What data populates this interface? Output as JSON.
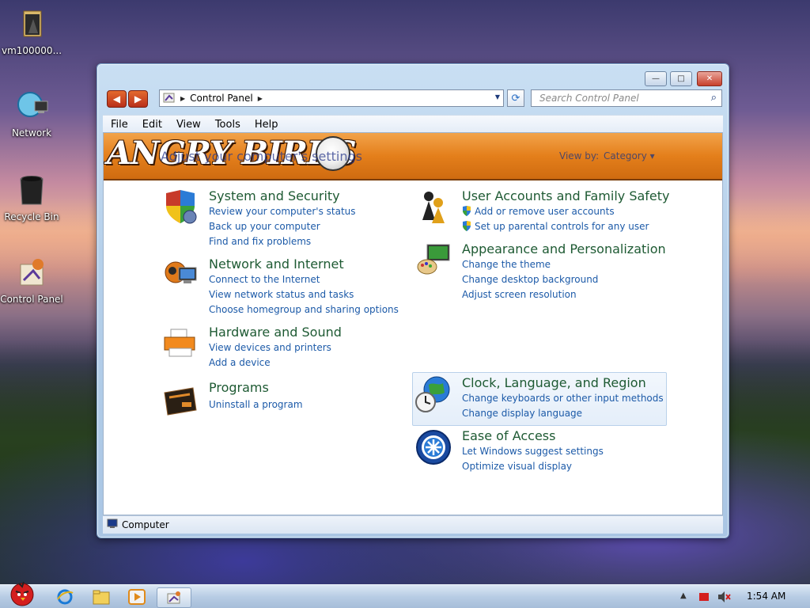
{
  "desktop": {
    "icons": [
      {
        "label": "vm100000..."
      },
      {
        "label": "Network"
      },
      {
        "label": "Recycle Bin"
      },
      {
        "label": "Control Panel"
      }
    ]
  },
  "window": {
    "controls": {
      "minimize": "—",
      "maximize": "□",
      "close": "✕"
    },
    "address": {
      "segment": "Control Panel"
    },
    "search": {
      "placeholder": "Search Control Panel"
    },
    "menu": [
      "File",
      "Edit",
      "View",
      "Tools",
      "Help"
    ],
    "banner": {
      "logo": "ANGRY BIRDS",
      "heading": "Adjust your computer's settings",
      "view_by_label": "View by:",
      "view_by_value": "Category"
    },
    "categories_left": [
      {
        "title": "System and Security",
        "links": [
          "Review your computer's status",
          "Back up your computer",
          "Find and fix problems"
        ]
      },
      {
        "title": "Network and Internet",
        "links": [
          "Connect to the Internet",
          "View network status and tasks",
          "Choose homegroup and sharing options"
        ]
      },
      {
        "title": "Hardware and Sound",
        "links": [
          "View devices and printers",
          "Add a device"
        ]
      },
      {
        "title": "Programs",
        "links": [
          "Uninstall a program"
        ]
      }
    ],
    "categories_right": [
      {
        "title": "User Accounts and Family Safety",
        "links": [
          "Add or remove user accounts",
          "Set up parental controls for any user"
        ]
      },
      {
        "title": "Appearance and Personalization",
        "links": [
          "Change the theme",
          "Change desktop background",
          "Adjust screen resolution"
        ]
      },
      {
        "title": "Clock, Language, and Region",
        "links": [
          "Change keyboards or other input methods",
          "Change display language"
        ]
      },
      {
        "title": "Ease of Access",
        "links": [
          "Let Windows suggest settings",
          "Optimize visual display"
        ]
      }
    ],
    "status": "Computer"
  },
  "taskbar": {
    "clock": "1:54 AM"
  }
}
